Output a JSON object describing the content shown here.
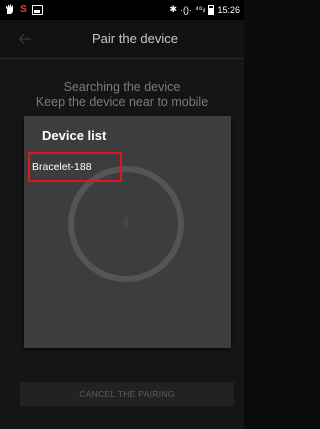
{
  "status_bar": {
    "bluetooth_glyph": "✱",
    "vibrate_glyph": "·()·",
    "signal_text": "⁴⁶ᵢₗ",
    "time": "15:26"
  },
  "app_bar": {
    "title": "Pair the device"
  },
  "search": {
    "line1": "Searching the device",
    "line2": "Keep the device near to mobile"
  },
  "modal": {
    "title": "Device list",
    "devices": [
      {
        "label": "Bracelet-188",
        "highlighted": true
      }
    ]
  },
  "footer": {
    "cancel_label": "CANCEL THE PAIRING"
  },
  "colors": {
    "highlight": "#e4151c",
    "background": "#151515",
    "modal": "#3d3d3d"
  },
  "icons": [
    "hand-icon",
    "s-app-icon",
    "image-icon",
    "bluetooth-icon",
    "vibrate-icon",
    "signal-icon",
    "battery-icon",
    "back-arrow-icon",
    "bluetooth-search-icon"
  ]
}
